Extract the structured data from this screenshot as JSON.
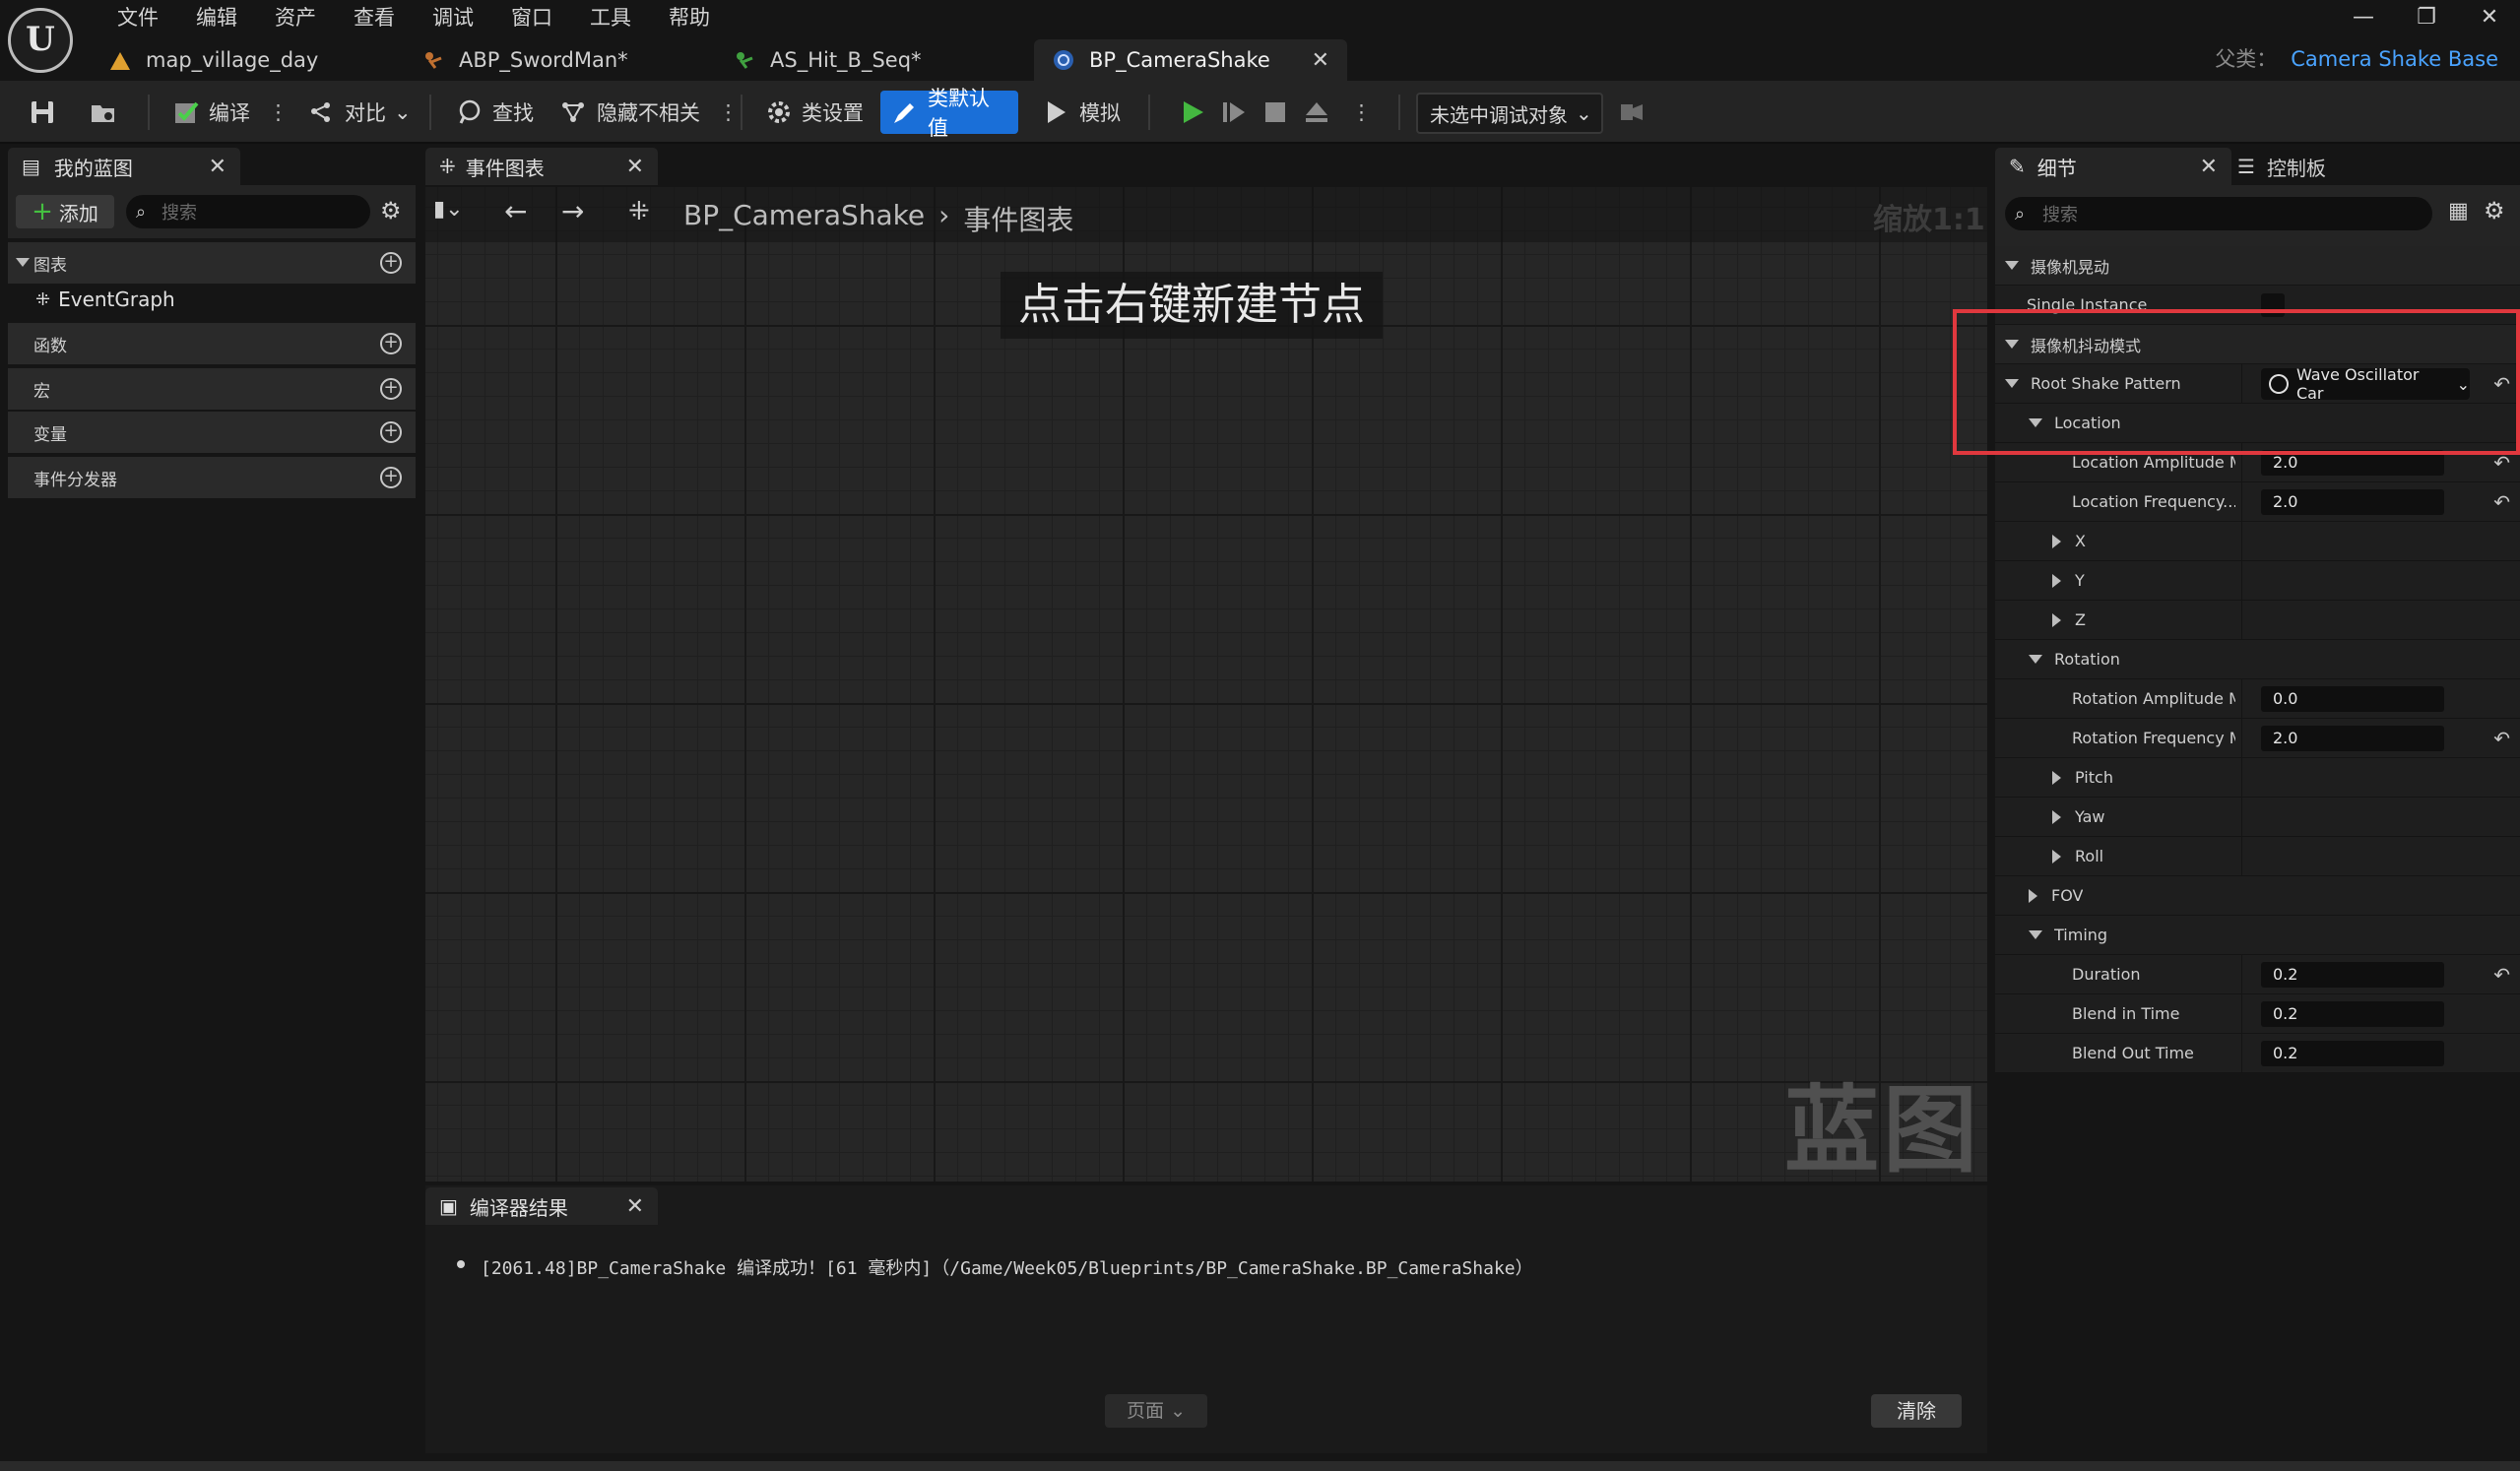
{
  "menu": [
    "文件",
    "编辑",
    "资产",
    "查看",
    "调试",
    "窗口",
    "工具",
    "帮助"
  ],
  "tabs": [
    {
      "label": "map_village_day",
      "icon": "level-icon"
    },
    {
      "label": "ABP_SwordMan*",
      "icon": "anim-blueprint-icon"
    },
    {
      "label": "AS_Hit_B_Seq*",
      "icon": "anim-sequence-icon"
    },
    {
      "label": "BP_CameraShake",
      "icon": "blueprint-icon",
      "active": true
    }
  ],
  "parent_class": {
    "label": "父类：",
    "value": "Camera Shake Base"
  },
  "toolbar": {
    "compile": "编译",
    "diff": "对比",
    "find": "查找",
    "hide_unrelated": "隐藏不相关",
    "class_settings": "类设置",
    "class_defaults": "类默认值",
    "simulate": "模拟",
    "debug_object": "未选中调试对象"
  },
  "left_panel": {
    "tab": "我的蓝图",
    "add": "添加",
    "search_placeholder": "搜索",
    "sections": [
      "图表",
      "函数",
      "宏",
      "变量",
      "事件分发器"
    ],
    "graph_item": "EventGraph"
  },
  "graph": {
    "tab": "事件图表",
    "breadcrumb_root": "BP_CameraShake",
    "breadcrumb_leaf": "事件图表",
    "zoom": "缩放1:1",
    "hint": "点击右键新建节点",
    "watermark": "蓝图"
  },
  "compiler": {
    "tab": "编译器结果",
    "message": "[2061.48]BP_CameraShake 编译成功！[61 毫秒内]（/Game/Week05/Blueprints/BP_CameraShake.BP_CameraShake）",
    "page": "页面",
    "clear": "清除"
  },
  "details": {
    "tab": "细节",
    "tab2": "控制板",
    "search_placeholder": "搜索",
    "cat_shake": "摄像机晃动",
    "single_instance": "Single Instance",
    "cat_pattern": "摄像机抖动模式",
    "root_shake_pattern": "Root Shake Pattern",
    "root_shake_value": "Wave Oscillator Car",
    "location": "Location",
    "loc_amp": "Location Amplitude M...",
    "loc_amp_val": "2.0",
    "loc_freq": "Location Frequency...",
    "loc_freq_val": "2.0",
    "x": "X",
    "y": "Y",
    "z": "Z",
    "rotation": "Rotation",
    "rot_amp": "Rotation Amplitude M...",
    "rot_amp_val": "0.0",
    "rot_freq": "Rotation Frequency M...",
    "rot_freq_val": "2.0",
    "pitch": "Pitch",
    "yaw": "Yaw",
    "roll": "Roll",
    "fov": "FOV",
    "timing": "Timing",
    "duration": "Duration",
    "duration_val": "0.2",
    "blend_in": "Blend in Time",
    "blend_in_val": "0.2",
    "blend_out": "Blend Out Time",
    "blend_out_val": "0.2"
  },
  "colors": {
    "accent": "#1a6fd8",
    "highlight": "#e0383e",
    "link": "#4aa3ff",
    "play": "#44b840"
  }
}
